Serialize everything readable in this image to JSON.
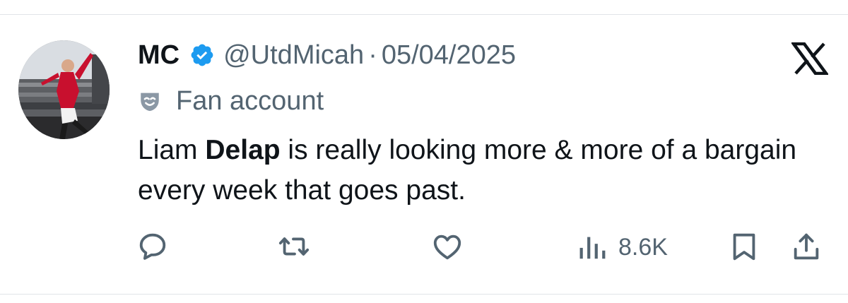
{
  "user": {
    "name": "MC",
    "handle": "@UtdMicah",
    "separator": "·",
    "date": "05/04/2025",
    "label": "Fan account"
  },
  "tweet": {
    "text_before": "Liam ",
    "text_bold": "Delap",
    "text_after": " is really looking more & more of a bargain every week that goes past."
  },
  "stats": {
    "views": "8.6K"
  },
  "icons": [
    "verified-badge-icon",
    "x-logo-icon",
    "fan-account-mask-icon",
    "reply-icon",
    "retweet-icon",
    "like-icon",
    "views-icon",
    "bookmark-icon",
    "share-icon"
  ],
  "colors": {
    "verified": "#1d9bf0",
    "muted": "#536471",
    "text": "#0f1419"
  }
}
